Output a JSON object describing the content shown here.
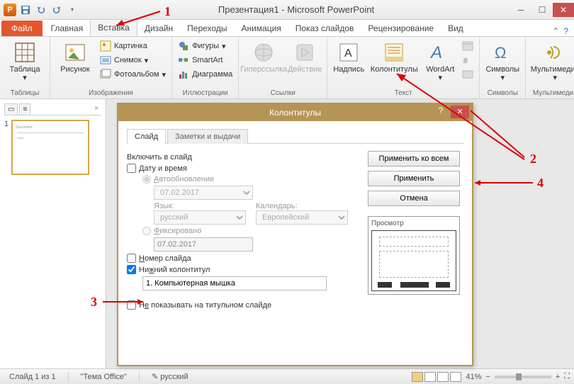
{
  "title": "Презентация1 - Microsoft PowerPoint",
  "qat": {
    "app_letter": "P"
  },
  "tabs": {
    "file": "Файл",
    "items": [
      "Главная",
      "Вставка",
      "Дизайн",
      "Переходы",
      "Анимация",
      "Показ слайдов",
      "Рецензирование",
      "Вид"
    ],
    "active_index": 1
  },
  "ribbon": {
    "tables": {
      "label": "Таблицы",
      "btn": "Таблица"
    },
    "images": {
      "label": "Изображения",
      "btn": "Рисунок",
      "pic": "Картинка",
      "shot": "Снимок",
      "album": "Фотоальбом"
    },
    "illus": {
      "label": "Иллюстрации",
      "shapes": "Фигуры",
      "smartart": "SmartArt",
      "chart": "Диаграмма"
    },
    "links": {
      "label": "Ссылки",
      "hyper": "Гиперссылка",
      "action": "Действие"
    },
    "text": {
      "label": "Текст",
      "textbox": "Надпись",
      "headerfooter": "Колонтитулы",
      "wordart": "WordArt",
      "datetime_ico": "",
      "number_ico": "",
      "object_ico": ""
    },
    "symbols": {
      "label": "Символы",
      "btn": "Символы"
    },
    "media": {
      "label": "Мультимедиа",
      "btn": "Мультимедиа"
    }
  },
  "panel": {
    "slide_num": "1"
  },
  "dialog": {
    "title": "Колонтитулы",
    "tab_slide": "Слайд",
    "tab_notes": "Заметки и выдачи",
    "include": "Включить в слайд",
    "datetime": "Дату и время",
    "auto": "Автообновление",
    "date_auto": "07.02.2017",
    "lang_lbl": "Язык:",
    "lang_val": "русский",
    "cal_lbl": "Календарь:",
    "cal_val": "Европейский",
    "fixed": "Фиксировано",
    "date_fixed": "07.02.2017",
    "slide_no": "Номер слайда",
    "footer": "Нижний колонтитул",
    "footer_val": "1. Компьютерная мышка",
    "no_title": "Не показывать на титульном слайде",
    "apply_all": "Применить ко всем",
    "apply": "Применить",
    "cancel": "Отмена",
    "preview": "Просмотр"
  },
  "status": {
    "slide": "Слайд 1 из 1",
    "theme": "\"Тема Office\"",
    "lang": "русский",
    "zoom": "41%"
  },
  "anno": {
    "n1": "1",
    "n2": "2",
    "n3": "3",
    "n4": "4"
  },
  "frag": "За"
}
